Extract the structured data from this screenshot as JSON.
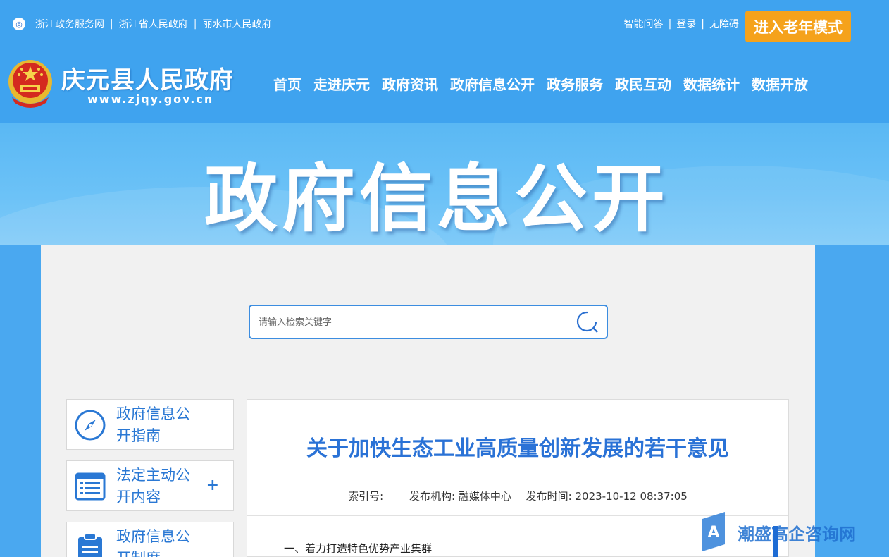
{
  "toplinks": [
    "浙江政务服务网",
    "浙江省人民政府",
    "丽水市人民政府"
  ],
  "rightlinks": [
    "智能问答",
    "登录",
    "无障碍"
  ],
  "elder_mode": "进入老年模式",
  "site": {
    "name": "庆元县人民政府",
    "url": "www.zjqy.gov.cn"
  },
  "nav": [
    "首页",
    "走进庆元",
    "政府资讯",
    "政府信息公开",
    "政务服务",
    "政民互动",
    "数据统计",
    "数据开放"
  ],
  "banner_title": "政府信息公开",
  "search": {
    "placeholder": "请输入检索关键字"
  },
  "sidebar": [
    {
      "label": "政府信息公开指南",
      "icon": "compass-icon",
      "expandable": false
    },
    {
      "label": "法定主动公开内容",
      "icon": "list-icon",
      "expandable": true,
      "expand_symbol": "+"
    },
    {
      "label": "政府信息公开制度",
      "icon": "clipboard-icon",
      "expandable": false
    }
  ],
  "article": {
    "title": "关于加快生态工业高质量创新发展的若干意见",
    "index_label": "索引号:",
    "index_value": "",
    "org_label": "发布机构:",
    "org_value": "融媒体中心",
    "time_label": "发布时间:",
    "time_value": "2023-10-12 08:37:05",
    "first_para": "一、着力打造特色优势产业集群"
  },
  "watermark": {
    "text": "潮盛高企咨询网",
    "logo_letter": "A"
  },
  "colors": {
    "header_blue": "#3fa3ef",
    "accent_orange": "#f5a21b",
    "title_blue": "#2a72d6"
  }
}
